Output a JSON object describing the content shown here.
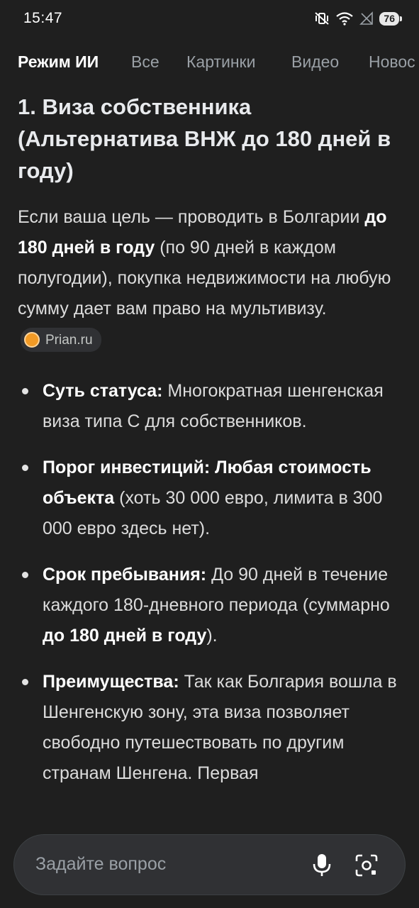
{
  "status_bar": {
    "time": "15:47",
    "battery": "76",
    "icons": [
      "mute-vibrate-icon",
      "wifi-icon",
      "signal-off-icon",
      "battery-icon"
    ]
  },
  "tabs": [
    {
      "label": "Режим ИИ",
      "active": true
    },
    {
      "label": "Все",
      "active": false
    },
    {
      "label": "Картинки",
      "active": false
    },
    {
      "label": "Видео",
      "active": false
    },
    {
      "label": "Новос",
      "active": false
    }
  ],
  "article": {
    "heading": "1. Виза собственника (Альтернатива ВНЖ до 180 дней в году)",
    "paragraph": {
      "part1": "Если ваша цель — проводить в Болгарии ",
      "bold1": "до 180 дней в году",
      "part2": " (по 90 дней в каждом полугодии), покупка недвижимости на любую сумму дает вам право на мультивизу.",
      "source_label": "Prian.ru"
    },
    "bullets": [
      {
        "bold": "Суть статуса:",
        "text": " Многократная шенгенская виза типа С для собственников.",
        "bold2": "",
        "text2": ""
      },
      {
        "bold": "Порог инвестиций: Любая стоимость объекта",
        "text": " (хоть 30 000 евро, лимита в 300 000 евро здесь нет).",
        "bold2": "",
        "text2": ""
      },
      {
        "bold": "Срок пребывания:",
        "text": " До 90 дней в течение каждого 180-дневного периода (суммарно ",
        "bold2": "до 180 дней в году",
        "text2": ")."
      },
      {
        "bold": "Преимущества:",
        "text": " Так как Болгария вошла в Шенгенскую зону, эта виза позволяет свободно путешествовать по другим странам Шенгена. Первая",
        "bold2": "",
        "text2": ""
      }
    ]
  },
  "ask_bar": {
    "placeholder": "Задайте вопрос",
    "mic_icon": "microphone-icon",
    "lens_icon": "camera-lens-icon"
  }
}
